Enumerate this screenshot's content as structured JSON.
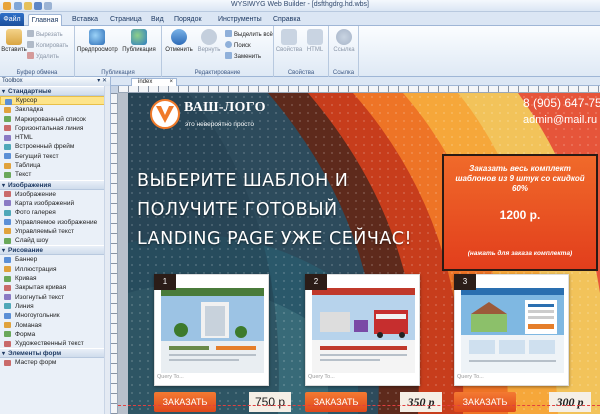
{
  "window": {
    "title": "WYSIWYG Web Builder - [dsfthgdrg.hd.wbs]"
  },
  "menu": {
    "file": "Файл",
    "tabs": [
      "Главная",
      "Вставка",
      "Страница",
      "Вид",
      "Порядок",
      "Инструменты",
      "Справка"
    ]
  },
  "ribbon": {
    "paste": "Вставить",
    "cut": "Вырезать",
    "copy": "Копировать",
    "delete": "Удалить",
    "clipboard_group": "Буфер обмена",
    "preview": "Предпросмотр",
    "publish": "Публикация",
    "publish_group": "Публикация",
    "undo": "Отменить",
    "redo": "Вернуть",
    "select_all": "Выделить всё",
    "find": "Поиск",
    "replace": "Заменить",
    "edit_group": "Редактирование",
    "properties": "Свойства",
    "html": "HTML",
    "properties_group": "Свойства",
    "link": "Ссылка",
    "link_group": "Ссылка"
  },
  "toolbox": {
    "title": "Toolbox",
    "categories": [
      {
        "name": "Стандартные",
        "items": [
          "Курсор",
          "Закладка",
          "Маркированный список",
          "Горизонтальная линия",
          "HTML",
          "Встроенный фрейм",
          "Бегущий текст",
          "Таблица",
          "Текст"
        ]
      },
      {
        "name": "Изображения",
        "items": [
          "Изображение",
          "Карта изображений",
          "Фото галерея",
          "Управляемое изображение",
          "Управляемый текст",
          "Слайд шоу"
        ]
      },
      {
        "name": "Рисование",
        "items": [
          "Баннер",
          "Иллюстрация",
          "Кривая",
          "Закрытая кривая",
          "Изогнутый текст",
          "Линия",
          "Многоугольник",
          "Ломаная",
          "Форма",
          "Художественный текст"
        ]
      },
      {
        "name": "Элементы форм",
        "items": [
          "Мастер форм"
        ]
      }
    ],
    "selected": "Курсор"
  },
  "document": {
    "tab": "index"
  },
  "site": {
    "logo": "ВАШ-ЛОГО",
    "logo_sub": "это невероятно просто",
    "phone": "8 (905) 647-75-",
    "email": "admin@mail.ru",
    "headline": [
      "ВЫБЕРИТЕ ШАБЛОН И",
      "ПОЛУЧИТЕ ГОТОВЫЙ",
      "LANDING PAGE УЖЕ СЕЙЧАС!"
    ],
    "offer_text": "Заказать весь комплект шаблонов из 9 штук со скидкой 60%",
    "offer_price": "1200 р.",
    "offer_note": "(нажать для заказа комплекта)",
    "cards": [
      {
        "num": "1",
        "order": "ЗАКАЗАТЬ",
        "price": "750 р",
        "caption": "Query To..."
      },
      {
        "num": "2",
        "order": "ЗАКАЗАТЬ",
        "price": "350 р",
        "caption": "Query To..."
      },
      {
        "num": "3",
        "order": "ЗАКАЗАТЬ",
        "price": "300 р",
        "caption": "Query To..."
      }
    ]
  },
  "colors": {
    "accent": "#f06a2a",
    "ribbon_blue": "#2f70c8",
    "badge": "#2b1d18"
  }
}
